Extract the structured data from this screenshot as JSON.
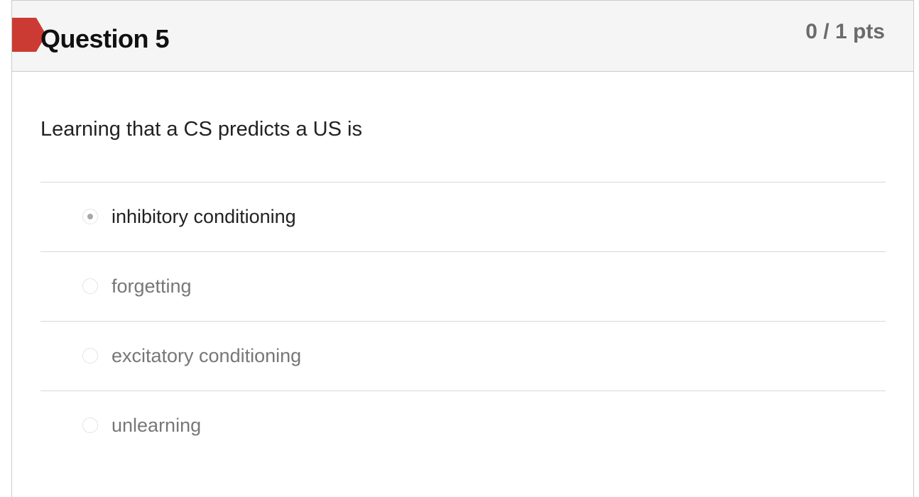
{
  "question": {
    "title": "Question 5",
    "points": "0 / 1 pts",
    "text": "Learning that a CS predicts a US is",
    "status": "incorrect",
    "status_color": "#c9302c"
  },
  "answers": [
    {
      "label": "inhibitory conditioning",
      "selected": true
    },
    {
      "label": "forgetting",
      "selected": false
    },
    {
      "label": "excitatory conditioning",
      "selected": false
    },
    {
      "label": "unlearning",
      "selected": false
    }
  ]
}
